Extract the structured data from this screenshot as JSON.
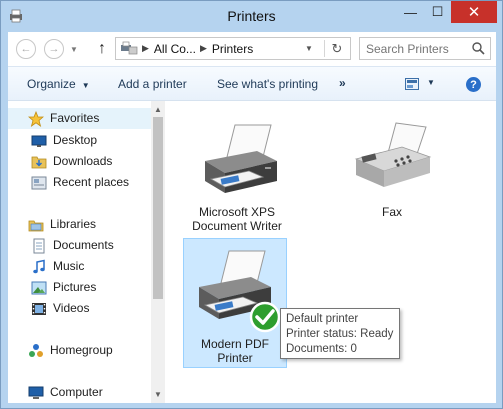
{
  "window": {
    "title": "Printers",
    "minimize_glyph": "—",
    "maximize_glyph": "☐",
    "close_glyph": "✕"
  },
  "address": {
    "crumbs": [
      "All Co...",
      "Printers"
    ],
    "search_placeholder": "Search Printers"
  },
  "commands": {
    "organize": "Organize",
    "add_printer": "Add a printer",
    "see_printing": "See what's printing",
    "more": "»",
    "help": "?"
  },
  "nav": {
    "favorites": "Favorites",
    "desktop": "Desktop",
    "downloads": "Downloads",
    "recent_places": "Recent places",
    "libraries": "Libraries",
    "documents": "Documents",
    "music": "Music",
    "pictures": "Pictures",
    "videos": "Videos",
    "homegroup": "Homegroup",
    "computer": "Computer"
  },
  "devices": [
    {
      "label": "Microsoft XPS Document Writer",
      "icon": "printer-icon"
    },
    {
      "label": "Fax",
      "icon": "fax-icon"
    },
    {
      "label": "Modern PDF Printer",
      "icon": "printer-default-icon"
    }
  ],
  "tooltip": {
    "line1": "Default printer",
    "line2": "Printer status: Ready",
    "line3": "Documents: 0"
  },
  "colors": {
    "title_bar": "#b5d3ef",
    "close_button": "#c7312a",
    "selection": "#cce8ff",
    "default_check": "#2e9e2e"
  }
}
